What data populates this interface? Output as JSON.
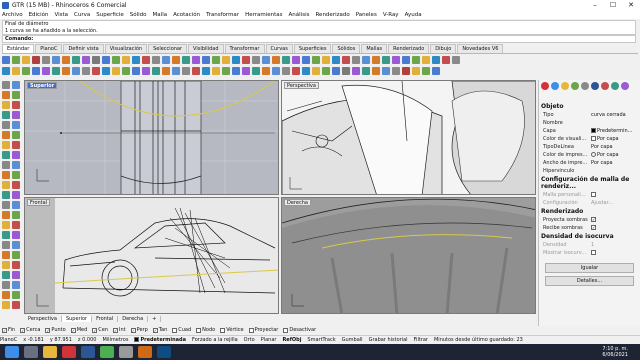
{
  "window": {
    "title": "GTR (15 MB) - Rhinoceros 6 Comercial",
    "controls": [
      "–",
      "☐",
      "✕"
    ]
  },
  "menu": [
    "Archivo",
    "Edición",
    "Vista",
    "Curva",
    "Superficie",
    "Sólido",
    "Malla",
    "Acotación",
    "Transformar",
    "Herramientas",
    "Análisis",
    "Renderizado",
    "Paneles",
    "V-Ray",
    "Ayuda"
  ],
  "command": {
    "history": [
      "Final de diámetro",
      "1 curva se ha añadido a la selección."
    ],
    "prompt": "Comando:"
  },
  "toolbar_tabs": [
    {
      "label": "Estándar",
      "active": true
    },
    {
      "label": "PlanoC"
    },
    {
      "label": "Definir vista"
    },
    {
      "label": "Visualización"
    },
    {
      "label": "Seleccionar"
    },
    {
      "label": "Visibilidad"
    },
    {
      "label": "Transformar"
    },
    {
      "label": "Curvas"
    },
    {
      "label": "Superficies"
    },
    {
      "label": "Sólidos"
    },
    {
      "label": "Mallas"
    },
    {
      "label": "Renderizado"
    },
    {
      "label": "Dibujo"
    },
    {
      "label": "Novedades V6"
    }
  ],
  "viewports": {
    "top": "Superior",
    "persp": "Perspectiva",
    "front": "Frontal",
    "right": "Derecha"
  },
  "viewport_tabs": [
    "Perspectiva",
    "Superior",
    "Frontal",
    "Derecha",
    "+"
  ],
  "osnaps": [
    {
      "label": "Fin",
      "checked": true
    },
    {
      "label": "Cerca",
      "checked": true
    },
    {
      "label": "Punto",
      "checked": true
    },
    {
      "label": "Med",
      "checked": true
    },
    {
      "label": "Cen",
      "checked": true
    },
    {
      "label": "Int",
      "checked": true
    },
    {
      "label": "Perp",
      "checked": true
    },
    {
      "label": "Tan",
      "checked": true
    },
    {
      "label": "Cuad",
      "checked": false
    },
    {
      "label": "Nodo",
      "checked": false
    },
    {
      "label": "Vértice",
      "checked": false
    },
    {
      "label": "Proyectar",
      "checked": false
    },
    {
      "label": "Desactivar",
      "checked": false
    }
  ],
  "status": {
    "cplane": "PlanoC",
    "x": "x -0.181",
    "y": "y 87.951",
    "z": "z 0.000",
    "units": "Milímetros",
    "layer": "Predeterminada",
    "items": [
      "Forzado a la rejilla",
      "Orto",
      "Planar",
      "RefObj",
      "SmartTrack",
      "Gumball",
      "Grabar historial",
      "Filtrar",
      "Minutos desde último guardado: 23"
    ]
  },
  "clock": {
    "time": "7:10 p. m.",
    "date": "6/06/2021"
  },
  "properties": {
    "section_object": "Objeto",
    "rows": [
      {
        "key": "Tipo",
        "value": "curva cerrada"
      },
      {
        "key": "Nombre",
        "value": ""
      },
      {
        "key": "Capa",
        "value": "Predetermin...",
        "swatch": "#000000"
      },
      {
        "key": "Color de visuali...",
        "value": "Por capa",
        "swatch": "#ffffff"
      },
      {
        "key": "TipoDeLínea",
        "value": "Por capa"
      },
      {
        "key": "Color de impres...",
        "value": "Por capa",
        "radio": true
      },
      {
        "key": "Ancho de impre...",
        "value": "Por capa"
      },
      {
        "key": "Hipervínculo",
        "value": ""
      }
    ],
    "section_mesh": "Configuración de malla de renderiz...",
    "mesh_rows": [
      {
        "key": "Malla personali...",
        "value": ""
      },
      {
        "key": "Configuración",
        "value": "Ajustar..."
      }
    ],
    "section_render": "Renderizado",
    "render_rows": [
      {
        "key": "Proyecta sombras",
        "value": "✓"
      },
      {
        "key": "Recibe sombras",
        "value": "✓"
      }
    ],
    "section_iso": "Densidad de isocurva",
    "iso_rows": [
      {
        "key": "Densidad",
        "value": "1"
      },
      {
        "key": "Mostrar isocurv...",
        "value": ""
      }
    ],
    "match_button": "Igualar",
    "details_button": "Detalles..."
  }
}
